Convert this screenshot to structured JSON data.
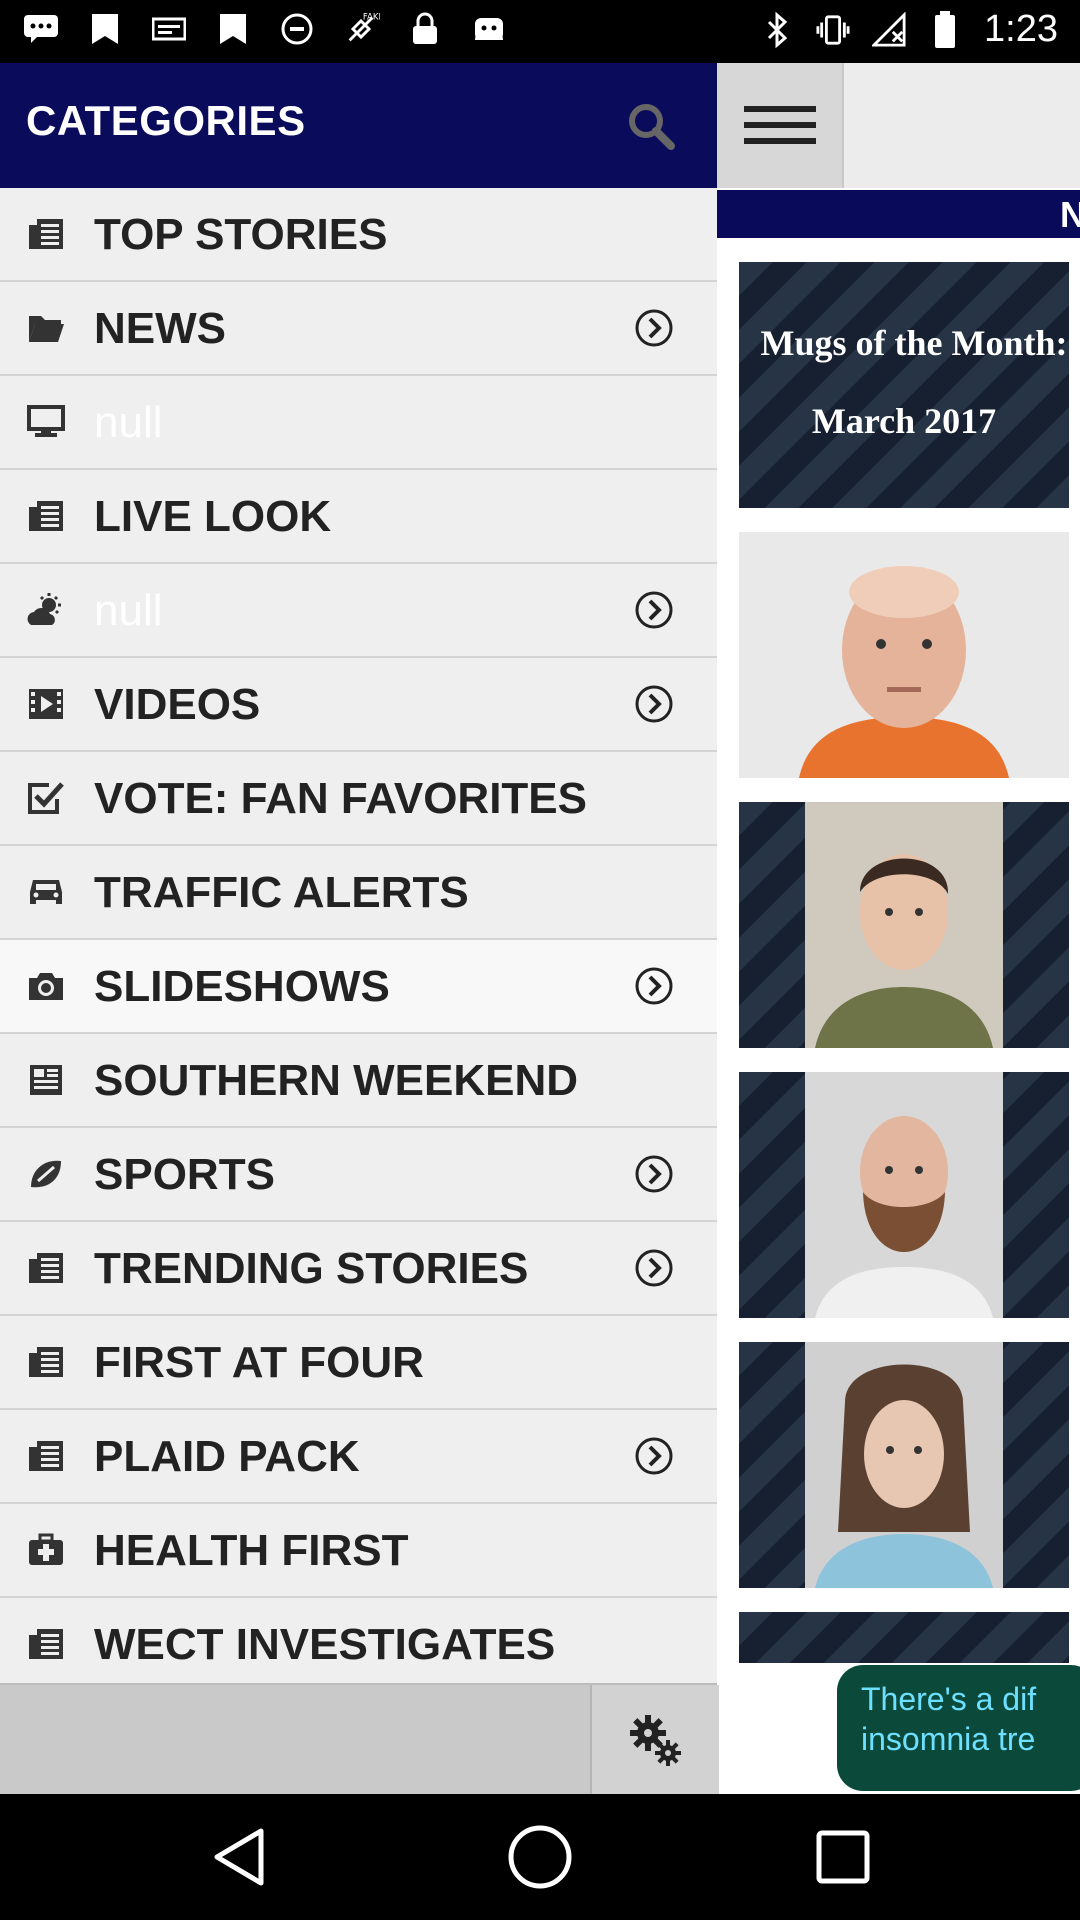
{
  "status_bar": {
    "time": "1:23",
    "left_icons": [
      "message-icon",
      "save-icon",
      "signal-icon",
      "save-icon",
      "no-sim-icon",
      "fake-gps-icon",
      "lock-icon",
      "android-icon"
    ],
    "right_icons": [
      "bluetooth-icon",
      "vibrate-icon",
      "no-signal-icon",
      "battery-icon"
    ]
  },
  "drawer": {
    "title": "CATEGORIES",
    "items": [
      {
        "label": "TOP STORIES",
        "icon": "article-icon",
        "chevron": false
      },
      {
        "label": "NEWS",
        "icon": "folder-icon",
        "chevron": true
      },
      {
        "label": "null",
        "icon": "monitor-icon",
        "chevron": false
      },
      {
        "label": "LIVE LOOK",
        "icon": "article-icon",
        "chevron": false
      },
      {
        "label": "null",
        "icon": "weather-icon",
        "chevron": true
      },
      {
        "label": "VIDEOS",
        "icon": "film-icon",
        "chevron": true
      },
      {
        "label": "VOTE: FAN FAVORITES",
        "icon": "checkbox-icon",
        "chevron": false
      },
      {
        "label": "TRAFFIC ALERTS",
        "icon": "car-icon",
        "chevron": false
      },
      {
        "label": "SLIDESHOWS",
        "icon": "camera-icon",
        "chevron": true
      },
      {
        "label": "SOUTHERN WEEKEND",
        "icon": "newspaper-icon",
        "chevron": false
      },
      {
        "label": "SPORTS",
        "icon": "football-icon",
        "chevron": true
      },
      {
        "label": "TRENDING STORIES",
        "icon": "article-icon",
        "chevron": true
      },
      {
        "label": "FIRST AT FOUR",
        "icon": "article-icon",
        "chevron": false
      },
      {
        "label": "PLAID PACK",
        "icon": "article-icon",
        "chevron": true
      },
      {
        "label": "HEALTH FIRST",
        "icon": "medkit-icon",
        "chevron": false
      },
      {
        "label": "WECT INVESTIGATES",
        "icon": "article-icon",
        "chevron": false
      }
    ]
  },
  "right_panel": {
    "band_text": "N",
    "feature": {
      "line1": "Mugs of the Month:",
      "line2": "March 2017"
    }
  },
  "ad": {
    "line1": "There's a dif",
    "line2": "insomnia tre"
  },
  "colors": {
    "header": "#0b0b5c",
    "drawer_bg": "#efefef",
    "ad_bg": "#0b4a3a"
  }
}
